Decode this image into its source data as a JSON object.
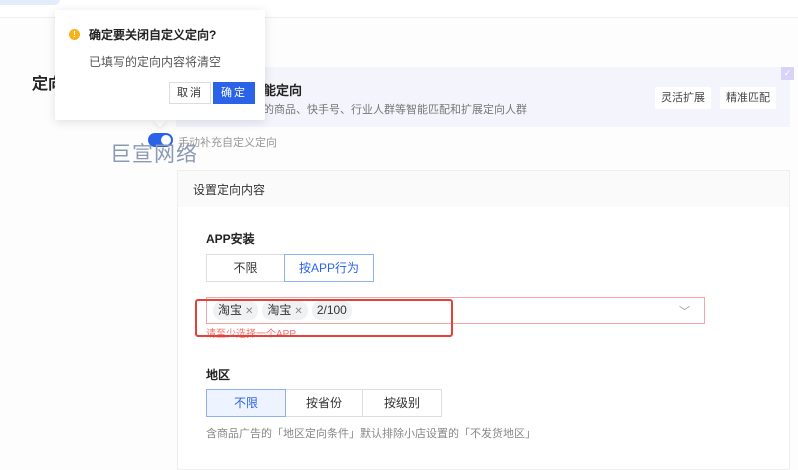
{
  "section": {
    "label": "定向"
  },
  "smart_card": {
    "title_fragment": "能定向",
    "desc_fragment": "的商品、快手号、行业人群等智能匹配和扩展定向人群",
    "buttons": [
      "灵活扩展",
      "精准匹配"
    ],
    "checked": true
  },
  "toggle": {
    "label": "手动补充自定义定向",
    "on": true
  },
  "watermark": "巨宣网络",
  "panel": {
    "title": "设置定向内容",
    "app_install": {
      "label": "APP安装",
      "options": [
        "不限",
        "按APP行为"
      ],
      "selected": "按APP行为",
      "tags": [
        "淘宝",
        "淘宝"
      ],
      "count": "2/100",
      "error": "请至少选择一个APP"
    },
    "region": {
      "label": "地区",
      "options": [
        "不限",
        "按省份",
        "按级别"
      ],
      "selected": "不限",
      "note": "含商品广告的「地区定向条件」默认排除小店设置的「不发货地区」"
    }
  },
  "popconfirm": {
    "title": "确定要关闭自定义定向?",
    "message": "已填写的定向内容将清空",
    "cancel": "取消",
    "ok": "确定"
  },
  "colors": {
    "primary": "#2b63e8",
    "error": "#e5413b",
    "warning": "#f7b21a"
  }
}
